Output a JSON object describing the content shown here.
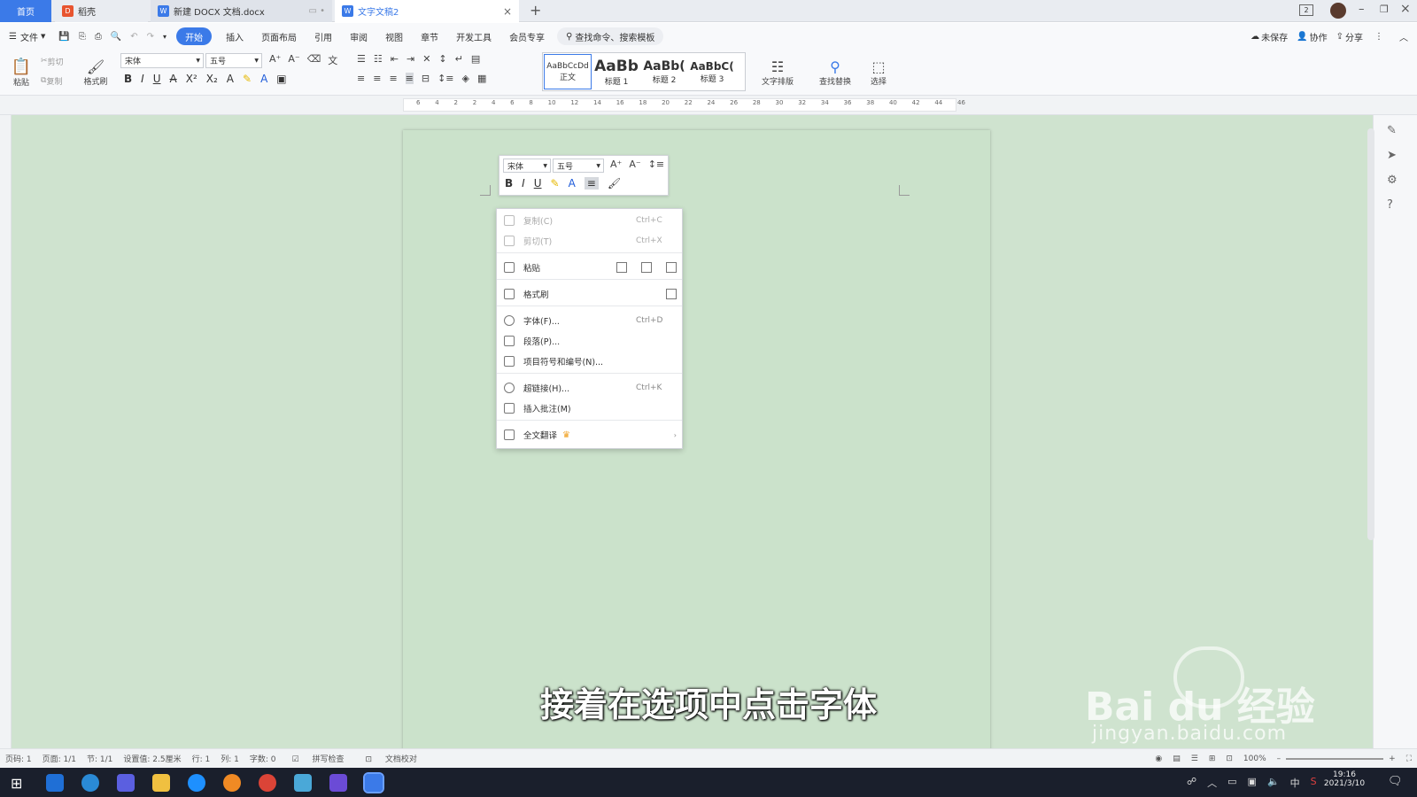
{
  "tabs": {
    "home": "首页",
    "tab1": "稻壳",
    "tab2": "新建 DOCX 文档.docx",
    "tab3": "文字文稿2",
    "new_tab": "+"
  },
  "menu": {
    "file": "文件",
    "items": [
      "开始",
      "插入",
      "页面布局",
      "引用",
      "审阅",
      "视图",
      "章节",
      "开发工具",
      "会员专享"
    ],
    "search_placeholder": "查找命令、搜索模板",
    "right": [
      "未保存",
      "协作",
      "分享"
    ]
  },
  "ribbon": {
    "paste": "粘贴",
    "cut": "剪切",
    "copy": "复制",
    "format_painter": "格式刷",
    "font": "宋体",
    "size": "五号",
    "styles": [
      {
        "sample": "AaBbCcDd",
        "name": "正文"
      },
      {
        "sample": "AaBb",
        "name": "标题 1"
      },
      {
        "sample": "AaBb(",
        "name": "标题 2"
      },
      {
        "sample": "AaBbC(",
        "name": "标题 3"
      }
    ],
    "text_layout": "文字排版",
    "find_replace": "查找替换",
    "select": "选择"
  },
  "ruler": {
    "h_ticks": [
      "6",
      "4",
      "2",
      "2",
      "4",
      "6",
      "8",
      "10",
      "12",
      "14",
      "16",
      "18",
      "20",
      "22",
      "24",
      "26",
      "28",
      "30",
      "32",
      "34",
      "36",
      "38",
      "40",
      "42",
      "44",
      "46"
    ]
  },
  "mini_toolbar": {
    "font": "宋体",
    "size": "五号"
  },
  "context_menu": {
    "copy": {
      "label": "复制(C)",
      "shortcut": "Ctrl+C"
    },
    "cut": {
      "label": "剪切(T)",
      "shortcut": "Ctrl+X"
    },
    "paste": {
      "label": "粘贴"
    },
    "format_painter": {
      "label": "格式刷"
    },
    "font": {
      "label": "字体(F)...",
      "shortcut": "Ctrl+D"
    },
    "paragraph": {
      "label": "段落(P)..."
    },
    "bullets": {
      "label": "项目符号和编号(N)..."
    },
    "hyperlink": {
      "label": "超链接(H)...",
      "shortcut": "Ctrl+K"
    },
    "comment": {
      "label": "插入批注(M)"
    },
    "translate": {
      "label": "全文翻译"
    }
  },
  "status": {
    "page_num": "页码: 1",
    "pages": "页面: 1/1",
    "section": "节: 1/1",
    "setting": "设置值: 2.5厘米",
    "row": "行: 1",
    "col": "列: 1",
    "words": "字数: 0",
    "spell": "拼写检查",
    "proof": "文档校对",
    "zoom": "100%"
  },
  "subtitle": "接着在选项中点击字体",
  "watermark": {
    "logo": "Bai du 经验",
    "url": "jingyan.baidu.com"
  },
  "taskbar": {
    "time": "19:16",
    "date": "2021/3/10",
    "ime": "中"
  }
}
